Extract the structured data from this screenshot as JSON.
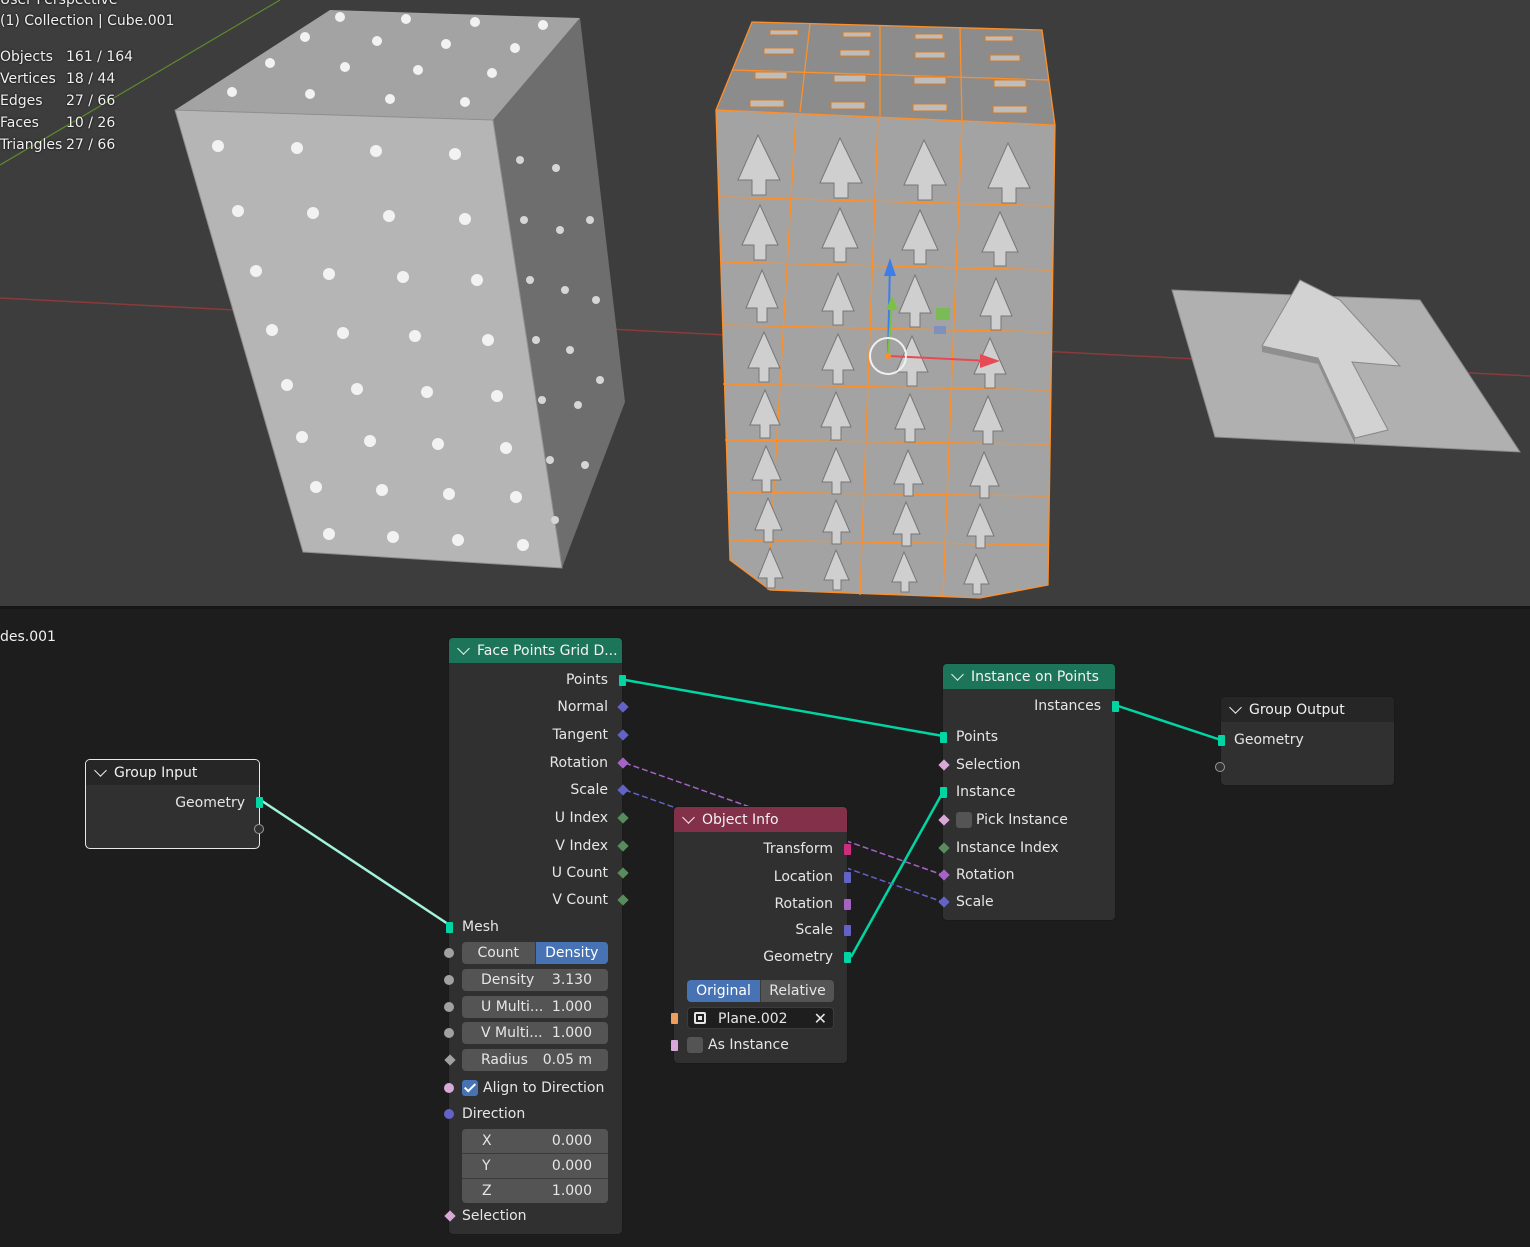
{
  "viewport": {
    "title_line": "User Perspective",
    "collection_line": "(1) Collection | Cube.001",
    "stats": [
      {
        "label": "Objects",
        "value": "161 / 164"
      },
      {
        "label": "Vertices",
        "value": "18 / 44"
      },
      {
        "label": "Edges",
        "value": "27 / 66"
      },
      {
        "label": "Faces",
        "value": "10 / 26"
      },
      {
        "label": "Triangles",
        "value": "27 / 66"
      }
    ]
  },
  "node_editor": {
    "tree_name": "des.001",
    "nodes": {
      "group_input": {
        "title": "Group Input",
        "geometry": "Geometry"
      },
      "face_points": {
        "title": "Face Points Grid D...",
        "outputs": [
          "Points",
          "Normal",
          "Tangent",
          "Rotation",
          "Scale",
          "U Index",
          "V Index",
          "U Count",
          "V Count"
        ],
        "mesh": "Mesh",
        "mode": {
          "options": [
            "Count",
            "Density"
          ],
          "selected": "Density"
        },
        "density": {
          "label": "Density",
          "value": "3.130"
        },
        "u_multi": {
          "label": "U Multi...",
          "value": "1.000"
        },
        "v_multi": {
          "label": "V Multi...",
          "value": "1.000"
        },
        "radius": {
          "label": "Radius",
          "value": "0.05 m"
        },
        "align": {
          "label": "Align to Direction",
          "checked": true
        },
        "direction": {
          "label": "Direction",
          "x": "0.000",
          "y": "0.000",
          "z": "1.000",
          "x_label": "X",
          "y_label": "Y",
          "z_label": "Z"
        },
        "selection": "Selection"
      },
      "object_info": {
        "title": "Object Info",
        "outputs": [
          "Transform",
          "Location",
          "Rotation",
          "Scale",
          "Geometry"
        ],
        "mode": {
          "options": [
            "Original",
            "Relative"
          ],
          "selected": "Original"
        },
        "object": "Plane.002",
        "as_instance": {
          "label": "As Instance",
          "checked": false
        }
      },
      "instance_on_points": {
        "title": "Instance on Points",
        "output": "Instances",
        "inputs": [
          "Points",
          "Selection",
          "Instance",
          "Pick Instance",
          "Instance Index",
          "Rotation",
          "Scale"
        ],
        "pick_instance_checked": false
      },
      "group_output": {
        "title": "Group Output",
        "geometry": "Geometry"
      }
    }
  },
  "colors": {
    "geometry_socket": "#00d6a3",
    "vector_socket": "#6363c7",
    "rotation_socket": "#a663c7",
    "int_socket": "#598c5c",
    "float_socket": "#a1a1a1",
    "matrix_socket": "#ce2c7e",
    "object_socket": "#ed9e5c",
    "selected_outline": "#ff8f28",
    "accent_blue": "#4772b3"
  }
}
